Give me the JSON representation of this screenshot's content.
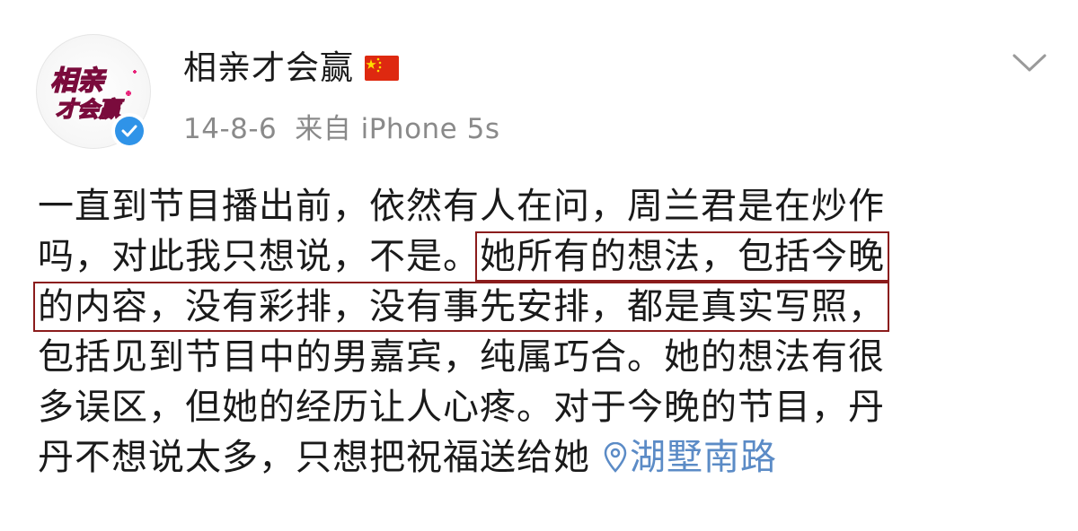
{
  "post": {
    "author": "相亲才会赢",
    "date": "14-8-6",
    "source": "来自 iPhone 5s",
    "avatar_logo_text_1": "相亲",
    "avatar_logo_text_2": "才会赢",
    "colors": {
      "highlight_border": "#8b1c1c",
      "location_link": "#5b8bc6",
      "verified": "#2f93e8",
      "flag_red": "#de2910",
      "flag_star": "#ffde00",
      "meta_gray": "#8a8a8a",
      "logo_pink": "#e8247a"
    },
    "icons": {
      "flag": "china-flag-icon",
      "verified": "verified-badge-icon",
      "chevron": "chevron-down-icon",
      "location": "location-pin-icon"
    },
    "body": {
      "line1": "一直到节目播出前，依然有人在问，周兰君是在炒作",
      "line2_a": "吗，对此我只想说，不是。",
      "line2_b": "她所有的想法，包括今晚",
      "line3": "的内容，没有彩排，没有事先安排，都是真实写照，",
      "line4": "包括见到节目中的男嘉宾，纯属巧合。她的想法有很",
      "line5": "多误区，但她的经历让人心疼。对于今晚的节目，丹",
      "line6": "丹不想说太多，只想把祝福送给她",
      "location": "湖墅南路"
    }
  }
}
